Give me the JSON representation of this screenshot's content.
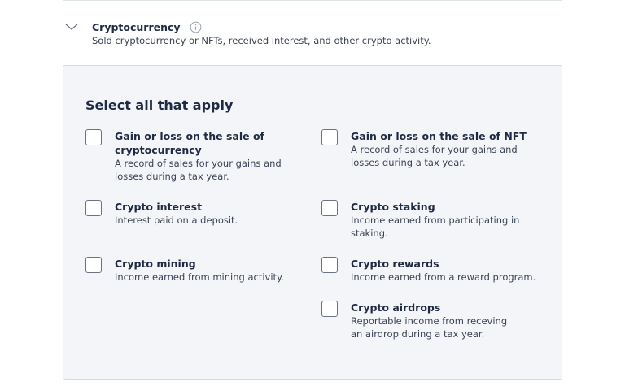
{
  "section": {
    "title": "Cryptocurrency",
    "subtitle": "Sold cryptocurrency or NFTs, received interest, and other crypto activity."
  },
  "panel": {
    "title": "Select all that apply",
    "options": [
      {
        "label": "Gain or loss on the sale of cryptocurrency",
        "description": "A record of sales for your gains and losses during a tax year.",
        "checked": false
      },
      {
        "label": "Gain or loss on the sale of NFT",
        "description": "A record of sales for your gains and losses during a tax year.",
        "checked": false
      },
      {
        "label": "Crypto interest",
        "description": "Interest paid on a deposit.",
        "checked": false
      },
      {
        "label": "Crypto staking",
        "description": "Income earned from participating in staking.",
        "checked": false
      },
      {
        "label": "Crypto mining",
        "description": "Income earned from mining activity.",
        "checked": false
      },
      {
        "label": "Crypto rewards",
        "description": "Income earned from a reward program.",
        "checked": false
      },
      {
        "label": "Crypto airdrops",
        "description": "Reportable income from receving an airdrop during a tax year.",
        "checked": false
      }
    ]
  },
  "icons": {
    "expand": "chevron-down-icon",
    "info": "info-icon"
  },
  "colors": {
    "text_primary": "#1f2a44",
    "panel_background": "#f4f5f8",
    "panel_border": "#d5d9e0"
  }
}
